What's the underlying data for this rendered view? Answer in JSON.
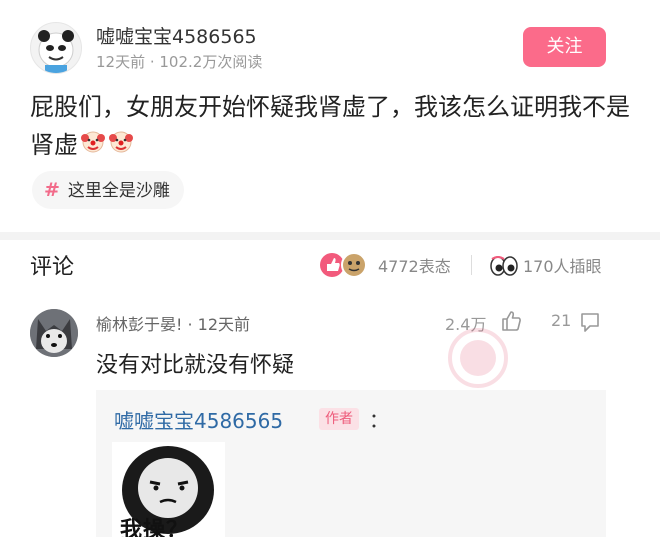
{
  "post": {
    "author": "嘘嘘宝宝4586565",
    "meta": "12天前 · 102.2万次阅读",
    "follow_label": "关注",
    "text": "屁股们，女朋友开始怀疑我肾虚了，我该怎么证明我不是肾虚",
    "tag": "这里全是沙雕",
    "emoji_icon": "clown-icon"
  },
  "comments_header": {
    "title": "评论",
    "reactions": "4772表态",
    "peeks": "170人插眼"
  },
  "comment": {
    "author": "榆林彭于晏! · 12天前",
    "likes": "2.4万",
    "replies": "21",
    "text": "没有对比就没有怀疑"
  },
  "reply": {
    "author": "嘘嘘宝宝4586565",
    "badge": "作者",
    "colon": "：",
    "meme_text": "我操？"
  },
  "colors": {
    "accent": "#fb6b8a",
    "link_blue": "#2f6aa5",
    "muted": "#999999"
  }
}
